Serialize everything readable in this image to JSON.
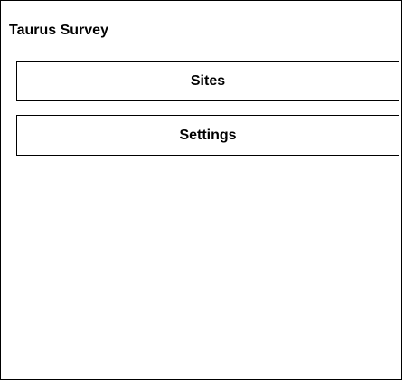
{
  "app": {
    "title": "Taurus Survey"
  },
  "menu": {
    "items": [
      {
        "label": "Sites"
      },
      {
        "label": "Settings"
      }
    ]
  }
}
